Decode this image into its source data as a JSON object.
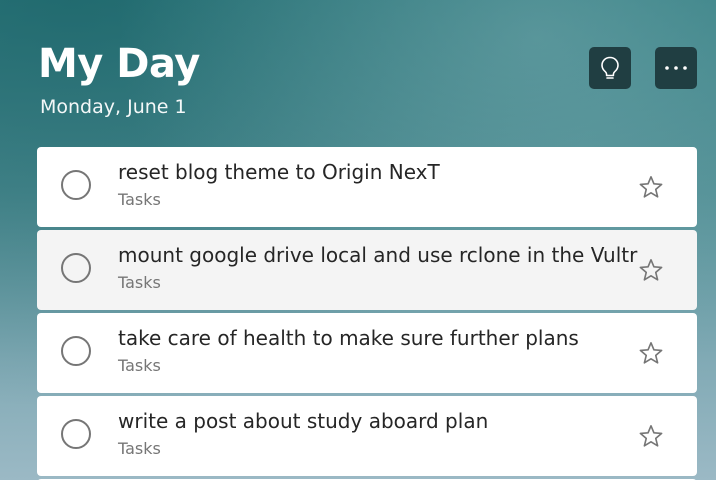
{
  "header": {
    "title": "My Day",
    "date": "Monday, June 1"
  },
  "theme": {
    "header_button_bg": "#203e42",
    "background_top": "#2f7c80",
    "background_bottom": "#9bb9c5"
  },
  "icons": {
    "suggestions": "lightbulb-icon",
    "more": "more-options-icon",
    "complete": "circle-checkbox-icon",
    "importance": "star-outline-icon"
  },
  "tasks": [
    {
      "title": "reset blog theme to Origin NexT",
      "list": "Tasks"
    },
    {
      "title": "mount google drive local and use rclone in the Vultr",
      "list": "Tasks"
    },
    {
      "title": "take care of health to make sure further plans",
      "list": "Tasks"
    },
    {
      "title": "write a post about study aboard plan",
      "list": "Tasks"
    }
  ]
}
